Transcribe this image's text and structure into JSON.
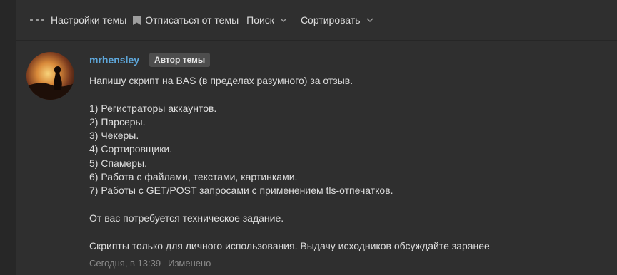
{
  "toolbar": {
    "thread_settings": "Настройки темы",
    "unsubscribe": "Отписаться от темы",
    "search": "Поиск",
    "sort": "Сортировать"
  },
  "post": {
    "username": "mrhensley",
    "author_badge": "Автор темы",
    "intro": "Напишу скрипт на BAS (в пределах разумного) за отзыв.",
    "items": [
      "1) Регистраторы аккаунтов.",
      "2) Парсеры.",
      "3) Чекеры.",
      "4) Сортировщики.",
      "5) Спамеры.",
      "6) Работа с файлами, текстами, картинками.",
      "7) Работы с GET/POST запросами с применением tls-отпечатков."
    ],
    "requirement": "От вас потребуется техническое задание.",
    "note": "Скрипты только для личного использования. Выдачу исходников обсуждайте заранее",
    "timestamp": "Сегодня, в 13:39",
    "edited": "Изменено"
  },
  "colors": {
    "username": "#5ea6d9",
    "badge_bg": "#4d4d4d",
    "panel_bg": "#2f2f2f"
  },
  "icons": {
    "menu": "more-dots-icon",
    "bookmark": "bookmark-icon",
    "dropdown": "chevron-down-icon"
  }
}
